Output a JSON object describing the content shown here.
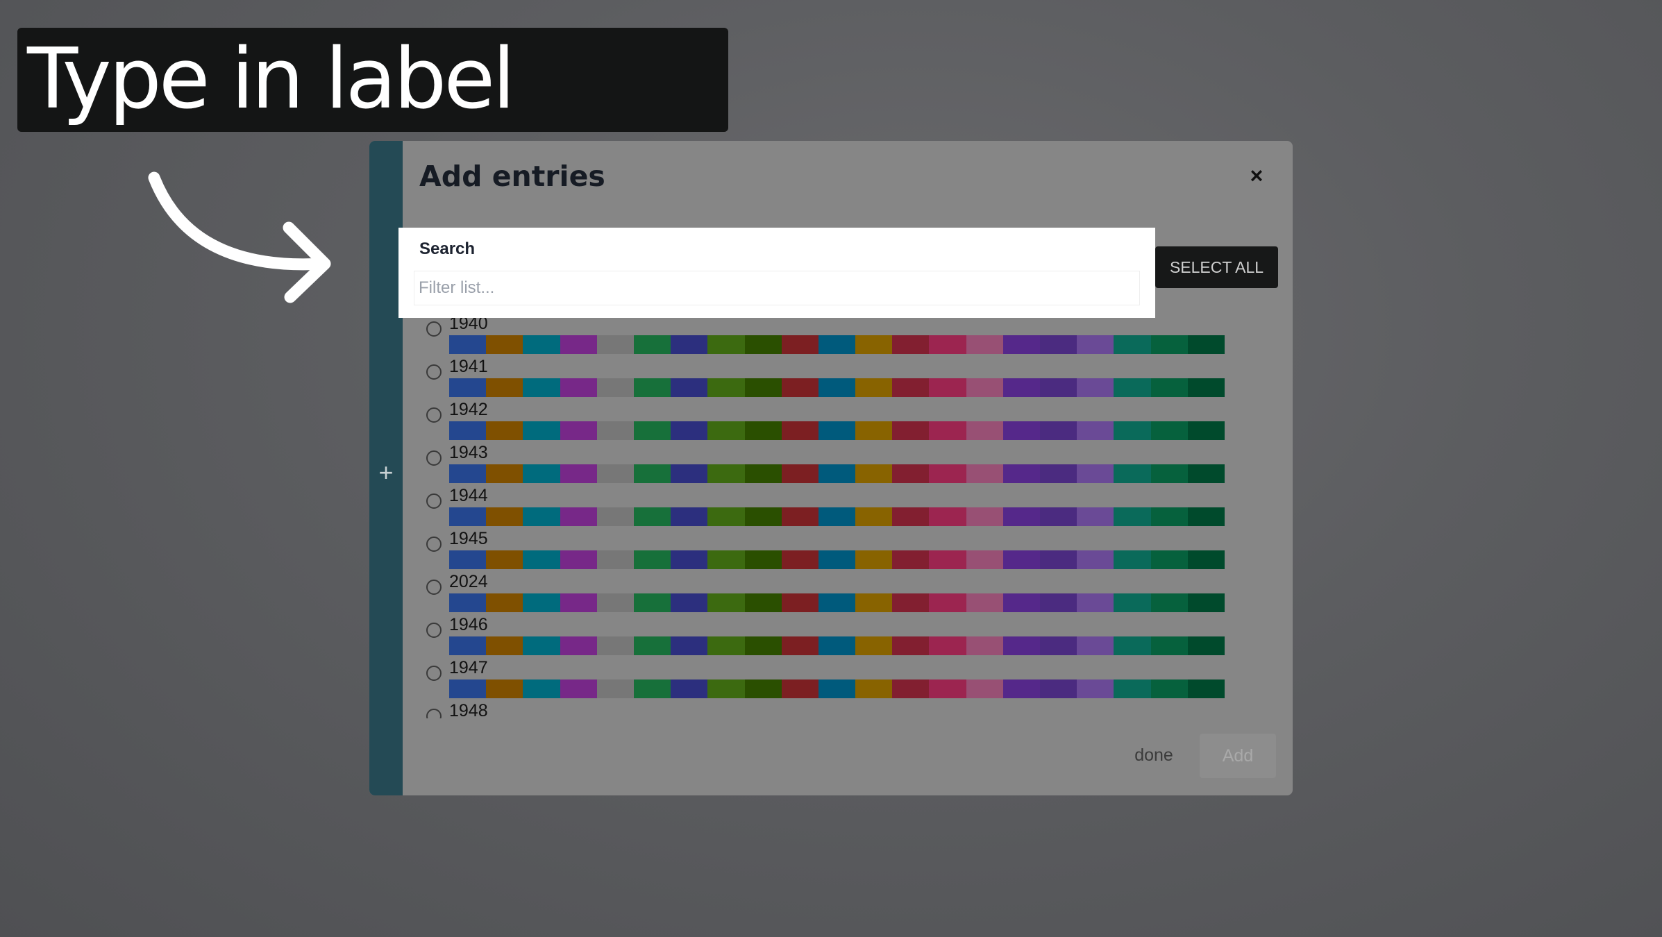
{
  "caption": {
    "text": "Type in label"
  },
  "modal": {
    "title": "Add entries",
    "close_label": "×",
    "sidebar_plus": "+",
    "select_all_label": "SELECT ALL",
    "search": {
      "label": "Search",
      "placeholder": "Filter list..."
    },
    "entries": [
      {
        "label": "1940"
      },
      {
        "label": "1941"
      },
      {
        "label": "1942"
      },
      {
        "label": "1943"
      },
      {
        "label": "1944"
      },
      {
        "label": "1945"
      },
      {
        "label": "2024"
      },
      {
        "label": "1946"
      },
      {
        "label": "1947"
      },
      {
        "label": "1948"
      }
    ],
    "palette": [
      "#24478f",
      "#7f5000",
      "#006b7d",
      "#772888",
      "#777777",
      "#17703a",
      "#2c2f7e",
      "#3c6a10",
      "#2a4f00",
      "#7c1f22",
      "#005a7c",
      "#886300",
      "#821f30",
      "#9c2550",
      "#985074",
      "#55288a",
      "#4b2b80",
      "#6a4a96",
      "#0a6a5a",
      "#06613d",
      "#004a2c"
    ],
    "done_label": "done",
    "add_label": "Add"
  },
  "colors": {
    "caption_bg": "#141515",
    "modal_bg": "#868686",
    "stripe": "#244a55",
    "select_all_bg": "#171818"
  }
}
